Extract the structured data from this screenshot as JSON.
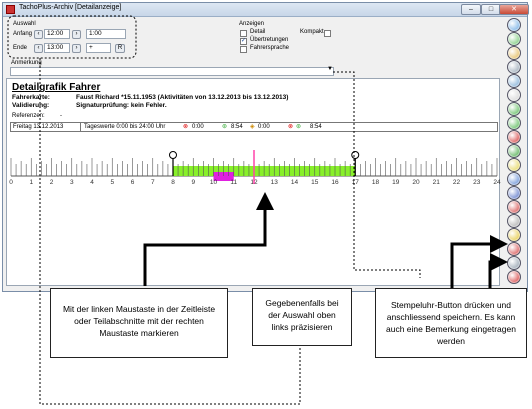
{
  "window": {
    "title": "TachoPlus-Archiv [Detailanzeige]",
    "min": "–",
    "max": "□",
    "close": "✕"
  },
  "auswahl": {
    "group_label": "Auswahl",
    "anfang_label": "Anfang",
    "anfang_value": "12:00",
    "anfang_extra": "1:00",
    "ende_label": "Ende",
    "ende_value": "13:00",
    "ende_extra": "+",
    "ende_r": "R",
    "prev": "‹",
    "next": "›"
  },
  "anzeigen": {
    "group_label": "Anzeigen",
    "options": [
      {
        "label": "Detail",
        "checked": false
      },
      {
        "label": "Übertretungen",
        "checked": true
      },
      {
        "label": "Fahrersprache",
        "checked": false
      }
    ],
    "kompakt_label": "Kompakt",
    "kompakt_checked": false
  },
  "anmerkung": {
    "label": "Anmerkung",
    "value": ""
  },
  "detail": {
    "heading": "Detailgrafik Fahrer",
    "fahrerkarte_label": "Fahrerkarte:",
    "fahrerkarte_value": "Faust Richard *15.11.1953  (Aktivitäten von 13.12.2013 bis 13.12.2013)",
    "validierung_label": "Validierung:",
    "validierung_value": "Signaturprüfung: kein Fehler.",
    "referenzen_label": "Referenzen:",
    "referenzen_value": "-"
  },
  "dayrow": {
    "date": "Freitag 13.12.2013",
    "tageswerte": "Tageswerte 0:00 bis 24:00 Uhr",
    "v1": "0:00",
    "v2": "8:54",
    "v3": "0:00",
    "v4": "8:54"
  },
  "timeline": {
    "hours": [
      "0",
      "1",
      "2",
      "3",
      "4",
      "5",
      "6",
      "7",
      "8",
      "9",
      "10",
      "11",
      "12",
      "13",
      "14",
      "15",
      "16",
      "17",
      "18",
      "19",
      "20",
      "21",
      "22",
      "23",
      "24"
    ]
  },
  "chart_data": {
    "type": "bar",
    "x_range": [
      0,
      24
    ],
    "activity_start": 8.0,
    "activity_end": 17.0,
    "selection_start": 10.0,
    "selection_end": 11.0,
    "selection_marker": 12.0,
    "colors": {
      "activity": "#88f02a",
      "selection": "#e020e0",
      "marker": "#ff44aa"
    }
  },
  "callouts": {
    "left": "Mit der linken Maustaste in der Zeitleiste oder Teilabschnitte mit der rechten Maustaste markieren",
    "middle": "Gegebenenfalls bei der Auswahl oben links präzisieren",
    "right": "Stempeluhr-Button drücken und anschliessend speichern. Es kann auch eine Bemerkung eingetragen werden"
  },
  "toolbar_icons": [
    "folder-icon",
    "refresh-icon",
    "pen-icon",
    "print-icon",
    "print-preview-icon",
    "document-icon",
    "zoom-in-icon",
    "zoom-out-icon",
    "stop-icon",
    "arrow-icon",
    "lightning-icon",
    "mail-icon",
    "calendar-icon",
    "no-entry-icon",
    "clock-icon",
    "star-icon",
    "delete-icon",
    "save-icon",
    "power-icon"
  ]
}
